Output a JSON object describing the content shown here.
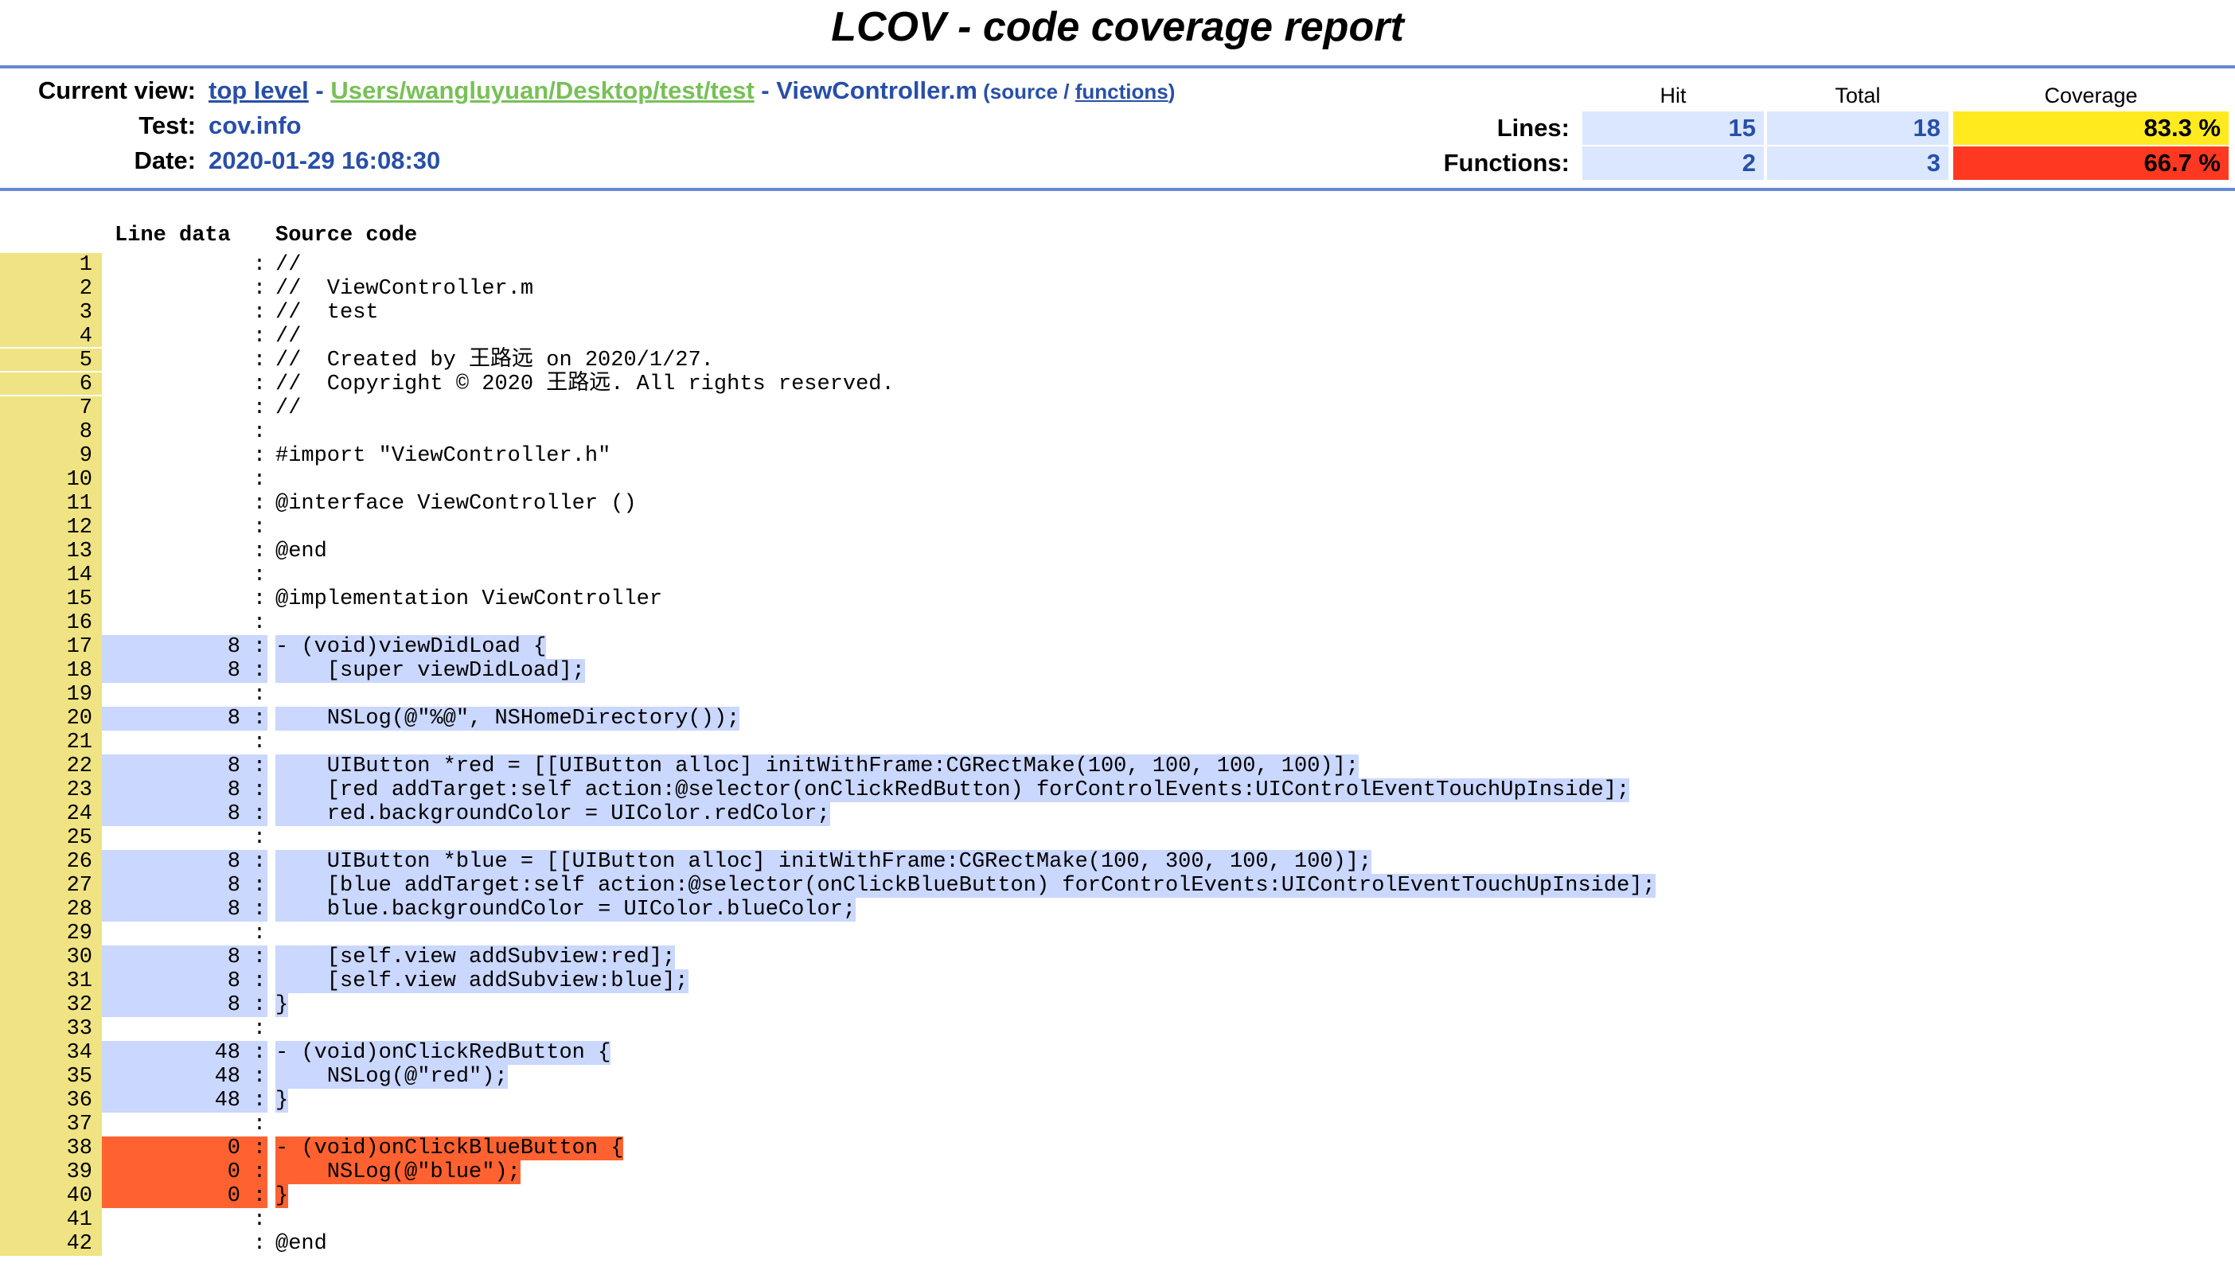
{
  "title": "LCOV - code coverage report",
  "header": {
    "current_view_label": "Current view:",
    "breadcrumb": {
      "top_level": "top level",
      "sep": " - ",
      "dir": "Users/wangluyuan/Desktop/test/test",
      "file": "ViewController.m",
      "open_paren": " (",
      "source": "source",
      "slash": " / ",
      "functions": "functions",
      "close_paren": ")"
    },
    "test_label": "Test:",
    "test_value": "cov.info",
    "date_label": "Date:",
    "date_value": "2020-01-29 16:08:30"
  },
  "summary": {
    "col_hit": "Hit",
    "col_total": "Total",
    "col_coverage": "Coverage",
    "lines": {
      "label": "Lines:",
      "hit": "15",
      "total": "18",
      "coverage": "83.3 %"
    },
    "functions": {
      "label": "Functions:",
      "hit": "2",
      "total": "3",
      "coverage": "66.7 %"
    },
    "colors": {
      "medium": "#ffea20",
      "low": "#ff3822",
      "hit_bg": "#cad7fe",
      "miss_bg": "#ff6230",
      "linenum_bg": "#efe383"
    }
  },
  "source": {
    "col_line_data": "Line data",
    "col_source_code": "Source code",
    "lines": [
      {
        "n": "1",
        "hits": "",
        "code": "//"
      },
      {
        "n": "2",
        "hits": "",
        "code": "//  ViewController.m"
      },
      {
        "n": "3",
        "hits": "",
        "code": "//  test"
      },
      {
        "n": "4",
        "hits": "",
        "code": "//"
      },
      {
        "n": "5",
        "hits": "",
        "code": "//  Created by 王路远 on 2020/1/27."
      },
      {
        "n": "6",
        "hits": "",
        "code": "//  Copyright © 2020 王路远. All rights reserved."
      },
      {
        "n": "7",
        "hits": "",
        "code": "//"
      },
      {
        "n": "8",
        "hits": "",
        "code": ""
      },
      {
        "n": "9",
        "hits": "",
        "code": "#import \"ViewController.h\""
      },
      {
        "n": "10",
        "hits": "",
        "code": ""
      },
      {
        "n": "11",
        "hits": "",
        "code": "@interface ViewController ()"
      },
      {
        "n": "12",
        "hits": "",
        "code": ""
      },
      {
        "n": "13",
        "hits": "",
        "code": "@end"
      },
      {
        "n": "14",
        "hits": "",
        "code": ""
      },
      {
        "n": "15",
        "hits": "",
        "code": "@implementation ViewController"
      },
      {
        "n": "16",
        "hits": "",
        "code": ""
      },
      {
        "n": "17",
        "hits": "8",
        "code": "- (void)viewDidLoad {"
      },
      {
        "n": "18",
        "hits": "8",
        "code": "    [super viewDidLoad];"
      },
      {
        "n": "19",
        "hits": "",
        "code": ""
      },
      {
        "n": "20",
        "hits": "8",
        "code": "    NSLog(@\"%@\", NSHomeDirectory());"
      },
      {
        "n": "21",
        "hits": "",
        "code": ""
      },
      {
        "n": "22",
        "hits": "8",
        "code": "    UIButton *red = [[UIButton alloc] initWithFrame:CGRectMake(100, 100, 100, 100)];"
      },
      {
        "n": "23",
        "hits": "8",
        "code": "    [red addTarget:self action:@selector(onClickRedButton) forControlEvents:UIControlEventTouchUpInside];"
      },
      {
        "n": "24",
        "hits": "8",
        "code": "    red.backgroundColor = UIColor.redColor;"
      },
      {
        "n": "25",
        "hits": "",
        "code": ""
      },
      {
        "n": "26",
        "hits": "8",
        "code": "    UIButton *blue = [[UIButton alloc] initWithFrame:CGRectMake(100, 300, 100, 100)];"
      },
      {
        "n": "27",
        "hits": "8",
        "code": "    [blue addTarget:self action:@selector(onClickBlueButton) forControlEvents:UIControlEventTouchUpInside];"
      },
      {
        "n": "28",
        "hits": "8",
        "code": "    blue.backgroundColor = UIColor.blueColor;"
      },
      {
        "n": "29",
        "hits": "",
        "code": ""
      },
      {
        "n": "30",
        "hits": "8",
        "code": "    [self.view addSubview:red];"
      },
      {
        "n": "31",
        "hits": "8",
        "code": "    [self.view addSubview:blue];"
      },
      {
        "n": "32",
        "hits": "8",
        "code": "}"
      },
      {
        "n": "33",
        "hits": "",
        "code": ""
      },
      {
        "n": "34",
        "hits": "48",
        "code": "- (void)onClickRedButton {"
      },
      {
        "n": "35",
        "hits": "48",
        "code": "    NSLog(@\"red\");"
      },
      {
        "n": "36",
        "hits": "48",
        "code": "}"
      },
      {
        "n": "37",
        "hits": "",
        "code": ""
      },
      {
        "n": "38",
        "hits": "0",
        "code": "- (void)onClickBlueButton {"
      },
      {
        "n": "39",
        "hits": "0",
        "code": "    NSLog(@\"blue\");"
      },
      {
        "n": "40",
        "hits": "0",
        "code": "}"
      },
      {
        "n": "41",
        "hits": "",
        "code": ""
      },
      {
        "n": "42",
        "hits": "",
        "code": "@end"
      }
    ]
  }
}
